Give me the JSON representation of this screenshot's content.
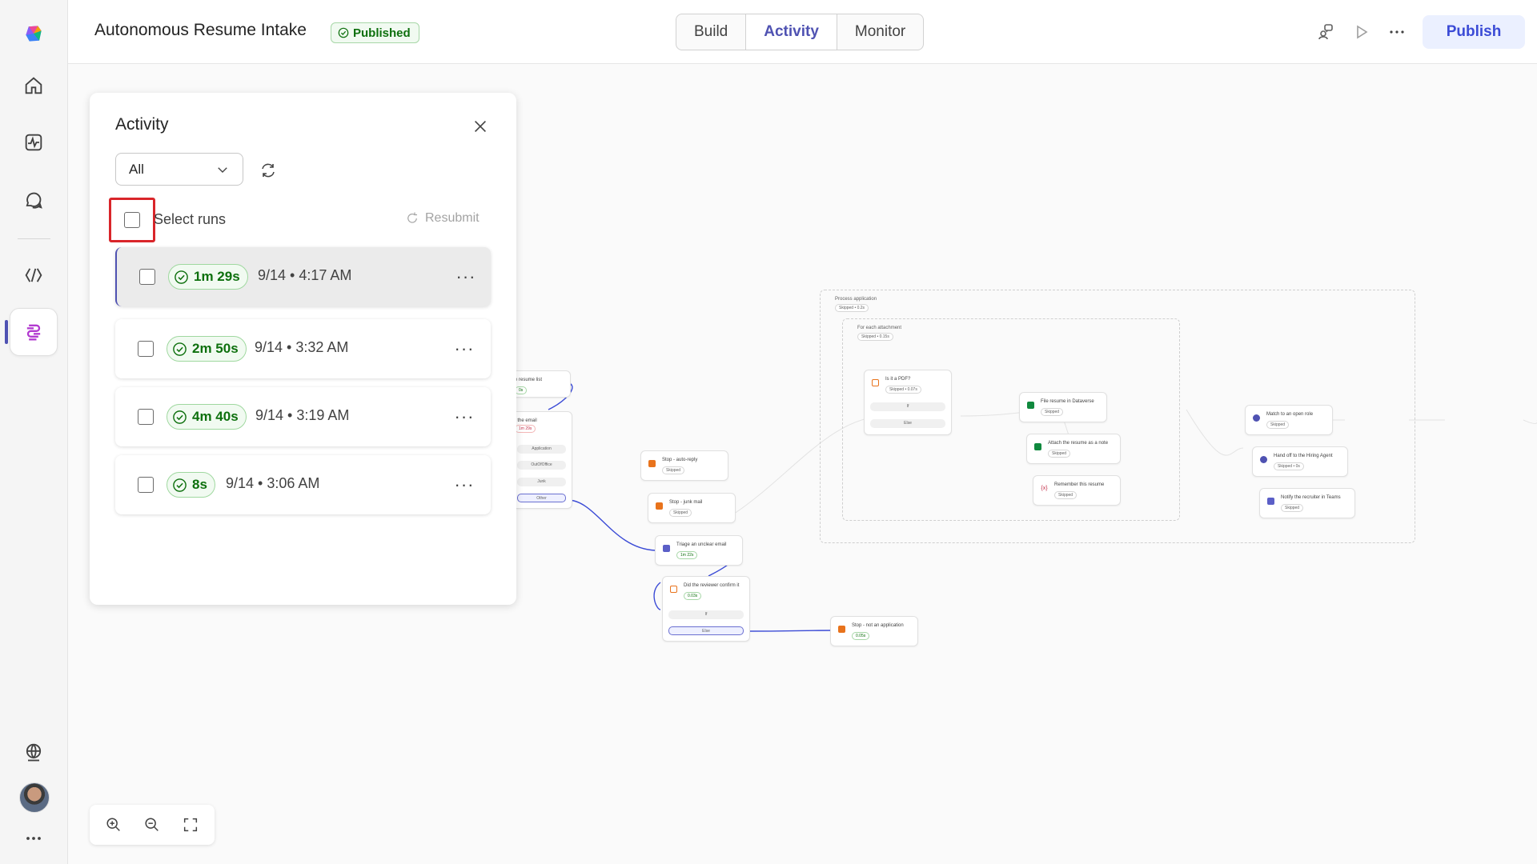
{
  "header": {
    "title": "Autonomous Resume Intake",
    "status": "Published",
    "tabs": [
      {
        "label": "Build"
      },
      {
        "label": "Activity"
      },
      {
        "label": "Monitor"
      }
    ],
    "publish_label": "Publish"
  },
  "activity_panel": {
    "title": "Activity",
    "filter_value": "All",
    "select_runs_label": "Select runs",
    "resubmit_label": "Resubmit",
    "runs": [
      {
        "duration": "1m 29s",
        "time": "9/14 • 4:17 AM"
      },
      {
        "duration": "2m 50s",
        "time": "9/14 • 3:32 AM"
      },
      {
        "duration": "4m 40s",
        "time": "9/14 • 3:19 AM"
      },
      {
        "duration": "8s",
        "time": "9/14 • 3:06 AM"
      }
    ]
  },
  "flow": {
    "nodes": {
      "resume_list": {
        "title": "e resume list",
        "status": "0s"
      },
      "email": {
        "title": "t the email",
        "status": "1m 29s"
      },
      "branch_application": "Application",
      "branch_ooo": "OutOfOffice",
      "branch_junk": "Junk",
      "branch_other": "Other",
      "auto_reply": {
        "title": "Stop - auto-reply",
        "status": "Skipped"
      },
      "junk_mail": {
        "title": "Stop - junk mail",
        "status": "Skipped"
      },
      "triage": {
        "title": "Triage an unclear email",
        "status": "1m 22s"
      },
      "reviewer": {
        "title": "Did the reviewer confirm it",
        "status": "0.03s"
      },
      "reviewer_if": "If",
      "reviewer_else": "Else",
      "not_application": {
        "title": "Stop - not an application",
        "status": "0.05s"
      },
      "process_application": {
        "title": "Process application",
        "status": "Skipped • 0.2s"
      },
      "for_each": {
        "title": "For each attachment",
        "status": "Skipped • 0.15s"
      },
      "is_pdf": {
        "title": "Is it a PDF?",
        "status": "Skipped • 0.07s"
      },
      "pdf_if": "If",
      "pdf_else": "Else",
      "file_resume": {
        "title": "File resume in Dataverse",
        "status": "Skipped"
      },
      "attach_resume": {
        "title": "Attach the resume as a note",
        "status": "Skipped"
      },
      "remember_resume": {
        "title": "Remember this resume",
        "status": "Skipped"
      },
      "match_role": {
        "title": "Match to an open role",
        "status": "Skipped"
      },
      "hand_off": {
        "title": "Hand off to the Hiring Agent",
        "status": "Skipped • 0s"
      },
      "notify_recruiter": {
        "title": "Notify the recruiter in Teams",
        "status": "Skipped"
      }
    }
  },
  "colors": {
    "accent": "#4f52b2",
    "success": "#0e700e",
    "highlight_frame": "#d9252a"
  }
}
